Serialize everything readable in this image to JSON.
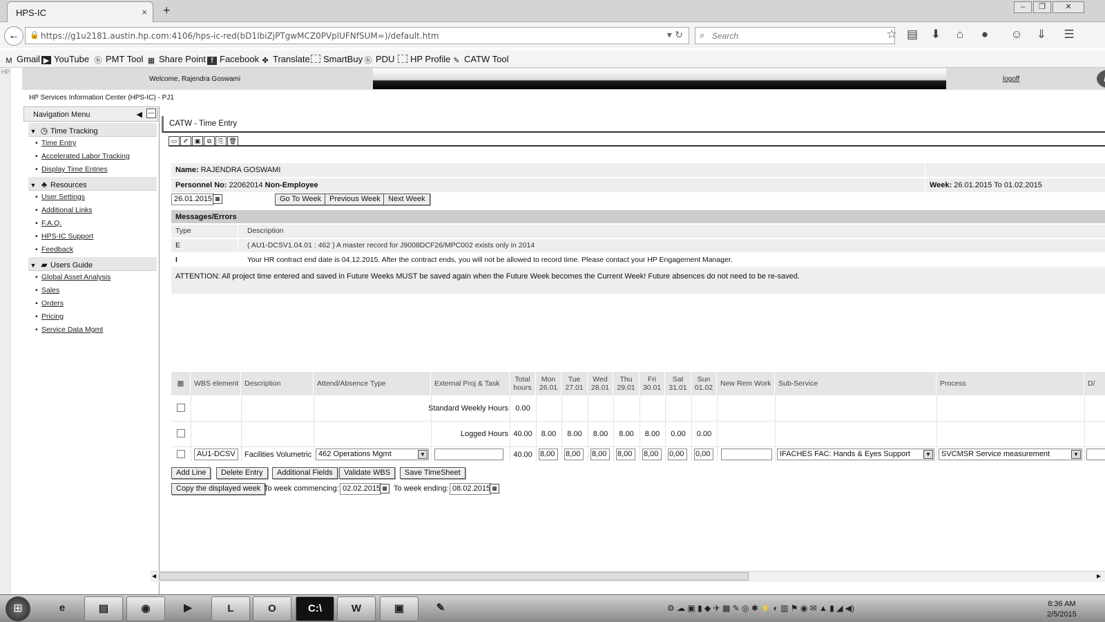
{
  "browser": {
    "tab_title": "HPS-IC",
    "tab_close": "×",
    "new_tab": "+",
    "url": "https://g1u2181.austin.hp.com:4106/hps-ic-red(bD1IbiZjPTgwMCZ0PVplUFNfSUM=)/default.htm",
    "search_placeholder": "Search",
    "bookmarks": [
      "Gmail",
      "YouTube",
      "PMT Tool",
      "Share Point",
      "Facebook",
      "Translate",
      "SmartBuy",
      "PDU",
      "HP Profile",
      "CATW Tool"
    ]
  },
  "header": {
    "welcome": "Welcome, Rajendra Goswami",
    "logoff": "logoff",
    "logo": "hp",
    "site_title": "HP Services Information Center (HPS-IC) - PJ1",
    "side_tag": "HP"
  },
  "nav": {
    "title": "Navigation Menu",
    "sections": [
      {
        "label": "Time Tracking",
        "icon": "clock-icon",
        "items": [
          "Time Entry",
          "Accelerated Labor Tracking",
          "Display Time Entries"
        ]
      },
      {
        "label": "Resources",
        "icon": "resources-icon",
        "items": [
          "User Settings",
          "Additional Links",
          "F.A.Q.",
          "HPS-IC Support",
          "Feedback"
        ]
      },
      {
        "label": "Users Guide",
        "icon": "book-icon",
        "items": [
          "Global Asset Analysis",
          "Sales",
          "Orders",
          "Pricing",
          "Service Data Mgmt"
        ]
      }
    ]
  },
  "page": {
    "title": "CATW - Time Entry",
    "name_label": "Name:",
    "name_value": "RAJENDRA GOSWAMI",
    "personnel_label": "Personnel No:",
    "personnel_value": "22062014",
    "personnel_type": "Non-Employee",
    "week_label": "Week:",
    "week_value": "26.01.2015 To 01.02.2015",
    "date_input": "26.01.2015",
    "buttons": {
      "go": "Go To Week",
      "prev": "Previous Week",
      "next": "Next Week"
    }
  },
  "messages": {
    "header": "Messages/Errors",
    "col_type": "Type",
    "col_desc": "Description",
    "rows": [
      {
        "type": "E",
        "text": "( AU1-DCSV1.04.01 : 462 ) A master record for J9008DCF26/MPC002 exists only in 2014"
      },
      {
        "type": "I",
        "text": "Your HR contract end date is 04.12.2015. After the contract ends, you will not be allowed to record time. Please contact your HP Engagement Manager."
      }
    ],
    "attention": "ATTENTION: All project time entered and saved in Future Weeks MUST be saved again when the Future Week becomes the Current Week! Future absences do not need to be re-saved."
  },
  "grid": {
    "headers": {
      "wbs": "WBS element",
      "desc": "Description",
      "attend": "Attend/Absence Type",
      "ext": "External Proj & Task",
      "total": "Total hours",
      "mon": "Mon 26.01",
      "tue": "Tue 27.01",
      "wed": "Wed 28.01",
      "thu": "Thu 29.01",
      "fri": "Fri 30.01",
      "sat": "Sat 31.01",
      "sun": "Sun 01.02",
      "rem": "New Rem Work",
      "sub": "Sub-Service",
      "proc": "Process",
      "da": "D/"
    },
    "std_label": "Standard Weekly Hours",
    "std_total": "0.00",
    "logged_label": "Logged Hours",
    "logged": {
      "total": "40.00",
      "mon": "8.00",
      "tue": "8.00",
      "wed": "8.00",
      "thu": "8.00",
      "fri": "8.00",
      "sat": "0.00",
      "sun": "0.00"
    },
    "entry": {
      "wbs": "AU1-DCSV",
      "desc": "Facilities Volumetric",
      "attend": "462 Operations Mgmt",
      "ext": "",
      "total": "40.00",
      "mon": "8,00",
      "tue": "8,00",
      "wed": "8,00",
      "thu": "8,00",
      "fri": "8,00",
      "sat": "0,00",
      "sun": "0,00",
      "rem": "",
      "sub": "IFACHES FAC: Hands & Eyes Support",
      "proc": "SVCMSR Service measurement"
    }
  },
  "actions": {
    "add_line": "Add Line",
    "delete_entry": "Delete Entry",
    "additional_fields": "Additional Fields",
    "validate_wbs": "Validate WBS",
    "save_timesheet": "Save TimeSheet",
    "copy_week": "Copy the displayed week",
    "to_week_commencing": "To week commencing:",
    "commencing_date": "02.02.2015",
    "to_week_ending": "To week ending:",
    "ending_date": "08.02.2015"
  },
  "taskbar": {
    "time": "8:36 AM",
    "date": "2/5/2015"
  }
}
